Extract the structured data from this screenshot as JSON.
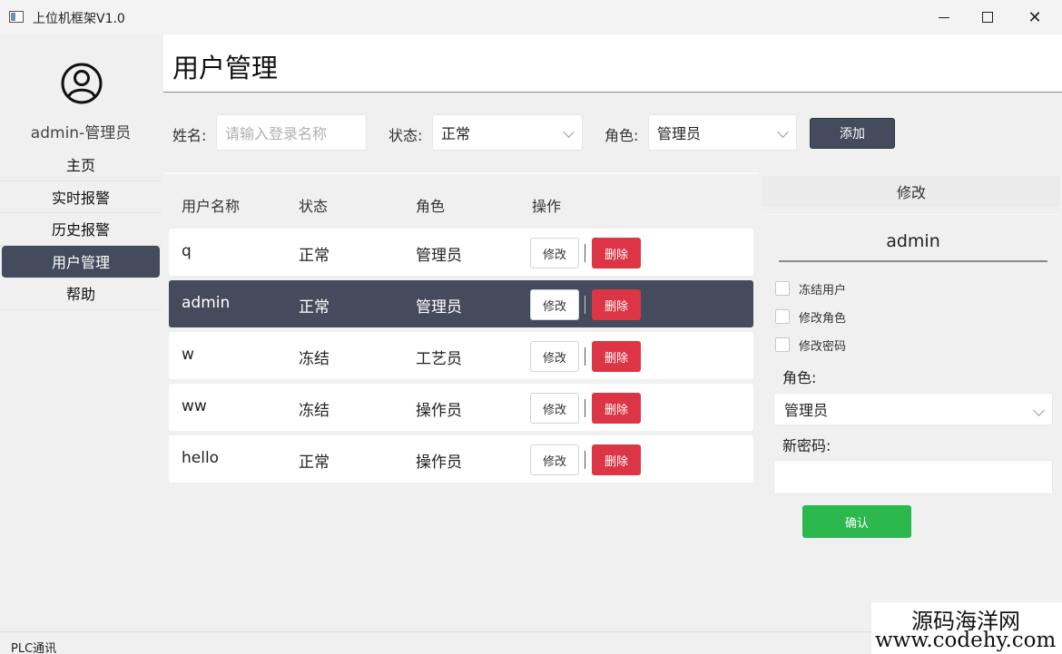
{
  "window": {
    "title": "上位机框架V1.0"
  },
  "sidebar": {
    "username": "admin-管理员",
    "items": [
      {
        "label": "主页"
      },
      {
        "label": "实时报警"
      },
      {
        "label": "历史报警"
      },
      {
        "label": "用户管理",
        "active": true
      },
      {
        "label": "帮助"
      }
    ]
  },
  "page": {
    "title": "用户管理"
  },
  "filter": {
    "name_label": "姓名:",
    "name_placeholder": "请输入登录名称",
    "status_label": "状态:",
    "status_value": "正常",
    "role_label": "角色:",
    "role_value": "管理员",
    "add_label": "添加"
  },
  "table": {
    "headers": [
      "用户名称",
      "状态",
      "角色",
      "操作"
    ],
    "edit_label": "修改",
    "delete_label": "删除",
    "rows": [
      {
        "name": "q",
        "status": "正常",
        "role": "管理员"
      },
      {
        "name": "admin",
        "status": "正常",
        "role": "管理员",
        "selected": true
      },
      {
        "name": "w",
        "status": "冻结",
        "role": "工艺员"
      },
      {
        "name": "ww",
        "status": "冻结",
        "role": "操作员"
      },
      {
        "name": "hello",
        "status": "正常",
        "role": "操作员"
      }
    ]
  },
  "edit": {
    "header": "修改",
    "username": "admin",
    "freeze_label": "冻结用户",
    "change_role_label": "修改角色",
    "change_pwd_label": "修改密码",
    "role_label": "角色:",
    "role_value": "管理员",
    "new_pwd_label": "新密码:",
    "confirm_label": "确认"
  },
  "statusbar": {
    "text": "PLC通讯"
  },
  "watermark": {
    "line1": "源码海洋网",
    "line2": "www.codehy.com"
  },
  "colors": {
    "accent": "#434b5c",
    "danger": "#dc3545",
    "success": "#2db84d"
  }
}
